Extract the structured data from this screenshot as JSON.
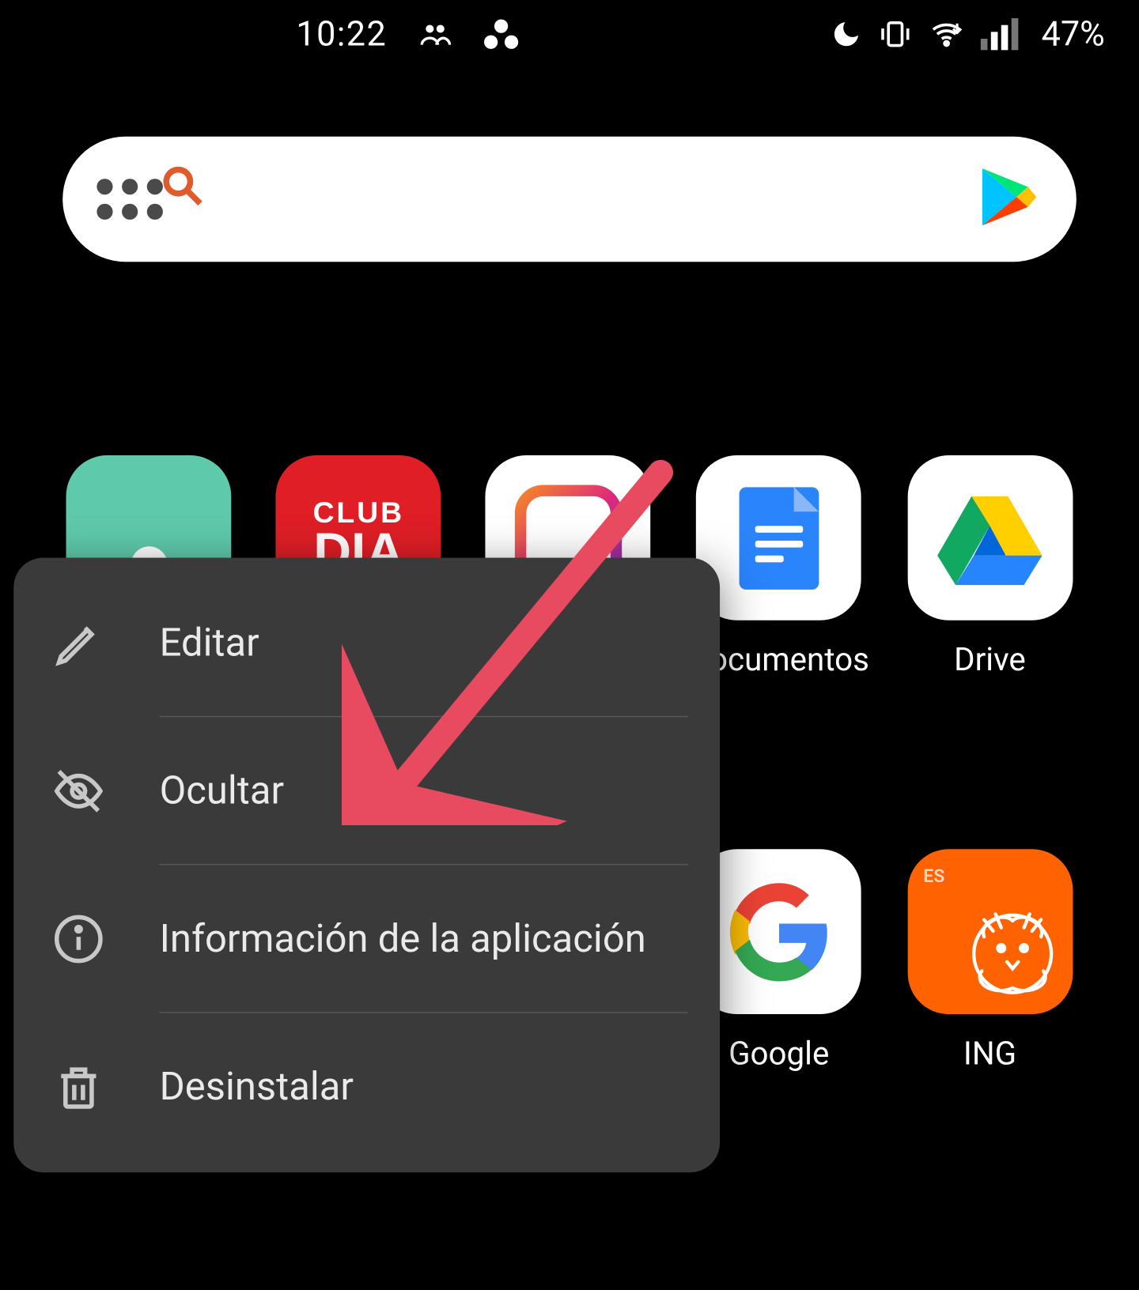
{
  "statusbar": {
    "time": "10:22",
    "battery": "47%"
  },
  "apps": {
    "row1": [
      {
        "name": "contacts",
        "label": ""
      },
      {
        "name": "club-dia",
        "label": "",
        "line1": "CLUB",
        "line2": "DIA"
      },
      {
        "name": "collage",
        "label": ""
      },
      {
        "name": "documentos",
        "label": "Documentos"
      },
      {
        "name": "drive",
        "label": "Drive"
      }
    ],
    "row2": [
      {
        "name": "google",
        "label": "Google"
      },
      {
        "name": "ing",
        "label": "ING",
        "badge": "ES"
      }
    ]
  },
  "context_menu": {
    "items": [
      {
        "icon": "pencil",
        "label": "Editar"
      },
      {
        "icon": "eye-off",
        "label": "Ocultar"
      },
      {
        "icon": "info",
        "label": "Información de la aplicación"
      },
      {
        "icon": "trash",
        "label": "Desinstalar"
      }
    ]
  },
  "annotation": {
    "arrow_target": "Ocultar"
  }
}
